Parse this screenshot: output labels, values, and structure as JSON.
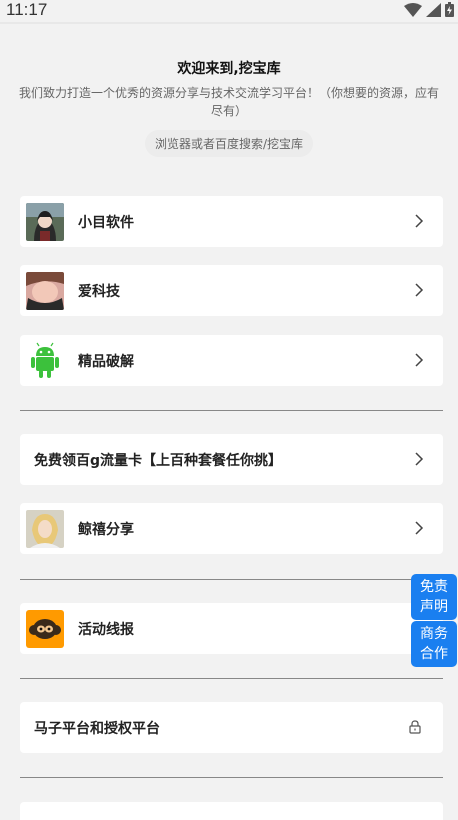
{
  "status": {
    "time": "11:17"
  },
  "header": {
    "title": "欢迎来到,挖宝库",
    "description": "我们致力打造一个优秀的资源分享与技术交流学习平台！（你想要的资源，应有尽有）",
    "search_hint": "浏览器或者百度搜索/挖宝库"
  },
  "cards": [
    {
      "label": "小目软件",
      "icon": "anime-avatar-icon"
    },
    {
      "label": "爱科技",
      "icon": "portrait-avatar-icon"
    },
    {
      "label": "精品破解",
      "icon": "android-icon"
    },
    {
      "label": "免费领百g流量卡【上百种套餐任你挑】",
      "icon": ""
    },
    {
      "label": "鲸禧分享",
      "icon": "portrait-avatar-icon"
    },
    {
      "label": "活动线报",
      "icon": "monkey-icon"
    },
    {
      "label": "马子平台和授权平台",
      "icon": "lock-icon"
    }
  ],
  "float": {
    "disclaimer_line1": "免责",
    "disclaimer_line2": "声明",
    "business_line1": "商务",
    "business_line2": "合作"
  },
  "colors": {
    "accent": "#1a7ff0",
    "background": "#f2f2f2"
  }
}
